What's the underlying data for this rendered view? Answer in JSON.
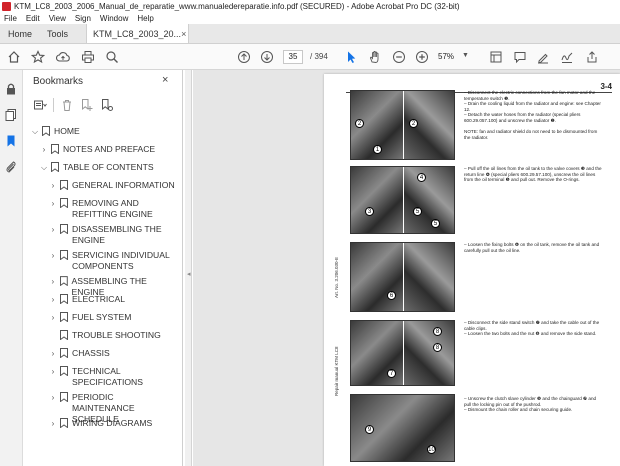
{
  "window": {
    "title": "KTM_LC8_2003_2006_Manual_de_reparatie_www.manualedereparatie.info.pdf (SECURED) - Adobe Acrobat Pro DC (32-bit)"
  },
  "menu": [
    "File",
    "Edit",
    "View",
    "Sign",
    "Window",
    "Help"
  ],
  "tabs": {
    "home": "Home",
    "tools": "Tools",
    "document": "KTM_LC8_2003_20...",
    "close": "×"
  },
  "toolbar": {
    "current_page": "35",
    "total_pages": "/ 394",
    "zoom": "57%",
    "zoom_dropdown": "▼"
  },
  "bookmarks": {
    "title": "Bookmarks",
    "close": "×",
    "items": [
      {
        "label": "HOME",
        "level": 0,
        "expanded": true
      },
      {
        "label": "NOTES AND PREFACE",
        "level": 1,
        "expanded": false
      },
      {
        "label": "TABLE OF CONTENTS",
        "level": 1,
        "expanded": true
      },
      {
        "label": "GENERAL INFORMATION",
        "level": 2,
        "expanded": false
      },
      {
        "label": "REMOVING AND REFITTING ENGINE",
        "level": 2,
        "expanded": false
      },
      {
        "label": "DISASSEMBLING THE ENGINE",
        "level": 2,
        "expanded": false
      },
      {
        "label": "SERVICING INDIVIDUAL COMPONENTS",
        "level": 2,
        "expanded": false
      },
      {
        "label": "ASSEMBLING THE ENGINE",
        "level": 2,
        "expanded": false
      },
      {
        "label": "ELECTRICAL",
        "level": 2,
        "expanded": false
      },
      {
        "label": "FUEL SYSTEM",
        "level": 2,
        "expanded": false
      },
      {
        "label": "TROUBLE SHOOTING",
        "level": 2,
        "expanded": null
      },
      {
        "label": "CHASSIS",
        "level": 2,
        "expanded": false
      },
      {
        "label": "TECHNICAL SPECIFICATIONS",
        "level": 2,
        "expanded": false
      },
      {
        "label": "PERIODIC MAINTENANCE SCHEDULE",
        "level": 2,
        "expanded": false
      },
      {
        "label": "WIRING DIAGRAMS",
        "level": 2,
        "expanded": false
      }
    ]
  },
  "page": {
    "number": "3-4",
    "side_label_1": "Art. No. 3.206.030-E",
    "side_label_2": "Repair manual KTM LC8",
    "blocks": [
      {
        "text": "– Disconnect the electric connections from the fan motor and the temperature switch ❶.\n– Drain the cooling liquid from the radiator and engine: see Chapter 12.\n– Detach the water hoses from the radiator (special pliers 600.29.057.100) and unscrew the radiator ❷.\n\nNOTE: fan and radiator shield do not need to be dismounted from the radiator."
      },
      {
        "text": "– Pull off the oil lines from the oil tank to the valve covers ❸ and the return line ❹ (special pliers 600.29.57.100), unscrew the oil lines from the oil terminal ❺ and pull out. Remove the O-rings."
      },
      {
        "text": "– Loosen the fixing bolts ❻ on the oil tank, remove the oil tank and carefully pull out the oil line."
      },
      {
        "text": "– Disconnect the side stand switch ❼ and take the cable out of the cable clips.\n– Loosen the two bolts and the nut ❽ and remove the side stand."
      },
      {
        "text": "– Unscrew the clutch slave cylinder ❾ and the chainguard ❿ and pull the locking pin out of the pushrod.\n– Dismount the chain roller and chain securing guide."
      }
    ],
    "callouts": [
      "1",
      "2",
      "2",
      "3",
      "4",
      "5",
      "5",
      "6",
      "7",
      "8",
      "8",
      "9",
      "10"
    ]
  }
}
